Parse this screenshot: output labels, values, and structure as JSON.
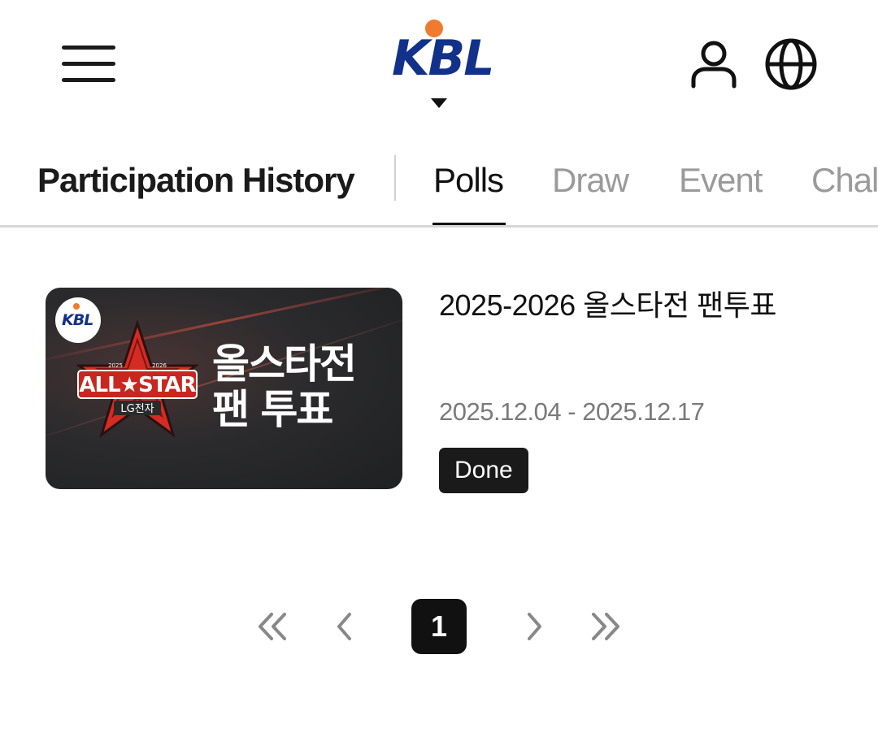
{
  "header": {
    "menu_icon": "hamburger-menu-icon",
    "logo_text": "KBL",
    "logo_colors": {
      "text": "#12318a",
      "ball": "#f07b30"
    },
    "user_icon": "user-icon",
    "language_icon": "globe-icon"
  },
  "tabs": {
    "history_label": "Participation History",
    "items": [
      {
        "label": "Polls",
        "active": true
      },
      {
        "label": "Draw",
        "active": false
      },
      {
        "label": "Event",
        "active": false
      },
      {
        "label": "Chal",
        "active": false
      }
    ]
  },
  "polls": [
    {
      "thumbnail": {
        "badge_text": "KBL",
        "star_text": "ALL★STAR",
        "sponsor_text": "LG전자",
        "season_left": "2025",
        "season_right": "2026",
        "title": "올스타전\n팬 투표"
      },
      "title": "2025-2026 올스타전 팬투표",
      "period": "2025.12.04 - 2025.12.17",
      "status": "Done"
    }
  ],
  "pagination": {
    "current_page": "1",
    "first_icon": "double-chevron-left-icon",
    "prev_icon": "chevron-left-icon",
    "next_icon": "chevron-right-icon",
    "last_icon": "double-chevron-right-icon"
  },
  "colors": {
    "accent": "#111111",
    "inactive_tab": "#9a9a9a",
    "muted_text": "#7a7a7a",
    "star_red": "#d42b24"
  }
}
